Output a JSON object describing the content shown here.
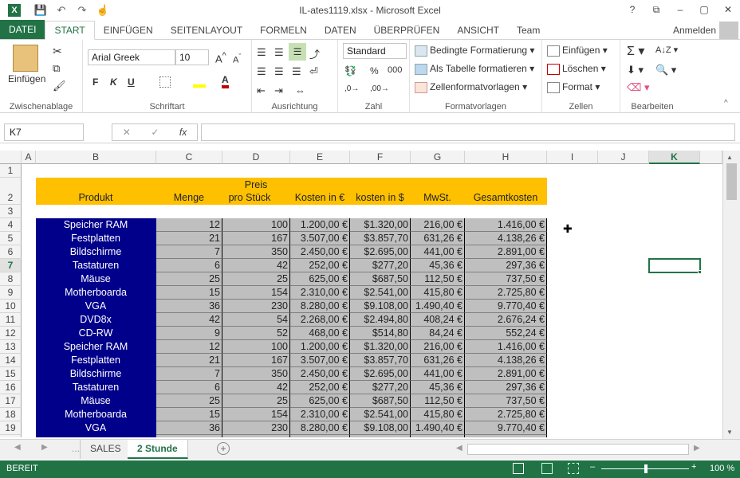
{
  "window": {
    "title": "IL-ates1119.xlsx - Microsoft Excel",
    "controls": [
      "?",
      "⧉",
      "–",
      "▢",
      "✕"
    ]
  },
  "qat": {
    "save": "💾",
    "undo": "↶",
    "redo": "↷",
    "touch": "☝"
  },
  "ribbon_tabs": [
    "DATEI",
    "START",
    "EINFÜGEN",
    "SEITENLAYOUT",
    "FORMELN",
    "DATEN",
    "ÜBERPRÜFEN",
    "ANSICHT",
    "Team"
  ],
  "signin": "Anmelden",
  "ribbon": {
    "clipboard": {
      "paste": "Einfügen",
      "label": "Zwischenablage"
    },
    "font": {
      "name": "Arial Greek",
      "size": "10",
      "bold": "F",
      "italic": "K",
      "underline": "U",
      "label": "Schriftart"
    },
    "alignment": {
      "label": "Ausrichtung"
    },
    "number": {
      "format": "Standard",
      "label": "Zahl"
    },
    "styles": {
      "cond": "Bedingte Formatierung",
      "table": "Als Tabelle formatieren",
      "cell": "Zellenformatvorlagen",
      "label": "Formatvorlagen"
    },
    "cells": {
      "insert": "Einfügen",
      "delete": "Löschen",
      "format": "Format",
      "label": "Zellen"
    },
    "editing": {
      "label": "Bearbeiten"
    }
  },
  "formula": {
    "namebox": "K7",
    "fx": "fx",
    "value": ""
  },
  "columns": [
    "A",
    "B",
    "C",
    "D",
    "E",
    "F",
    "G",
    "H",
    "I",
    "J",
    "K"
  ],
  "header_row": {
    "produkt": "Produkt",
    "menge": "Menge",
    "preis_1": "Preis",
    "preis_2": "pro Stück",
    "kosten_eur": "Kosten in €",
    "kosten_usd": "kosten in $",
    "mwst": "MwSt.",
    "gesamt": "Gesamtkosten"
  },
  "rows": [
    {
      "r": "4",
      "p": "Speicher RAM",
      "m": "12",
      "pr": "100",
      "e": "1.200,00 €",
      "u": "$1.320,00",
      "w": "216,00 €",
      "g": "1.416,00 €"
    },
    {
      "r": "5",
      "p": "Festplatten",
      "m": "21",
      "pr": "167",
      "e": "3.507,00 €",
      "u": "$3.857,70",
      "w": "631,26 €",
      "g": "4.138,26 €"
    },
    {
      "r": "6",
      "p": "Bildschirme",
      "m": "7",
      "pr": "350",
      "e": "2.450,00 €",
      "u": "$2.695,00",
      "w": "441,00 €",
      "g": "2.891,00 €"
    },
    {
      "r": "7",
      "p": "Tastaturen",
      "m": "6",
      "pr": "42",
      "e": "252,00 €",
      "u": "$277,20",
      "w": "45,36 €",
      "g": "297,36 €"
    },
    {
      "r": "8",
      "p": "Mäuse",
      "m": "25",
      "pr": "25",
      "e": "625,00 €",
      "u": "$687,50",
      "w": "112,50 €",
      "g": "737,50 €"
    },
    {
      "r": "9",
      "p": "Motherboarda",
      "m": "15",
      "pr": "154",
      "e": "2.310,00 €",
      "u": "$2.541,00",
      "w": "415,80 €",
      "g": "2.725,80 €"
    },
    {
      "r": "10",
      "p": "VGA",
      "m": "36",
      "pr": "230",
      "e": "8.280,00 €",
      "u": "$9.108,00",
      "w": "1.490,40 €",
      "g": "9.770,40 €"
    },
    {
      "r": "11",
      "p": "DVD8x",
      "m": "42",
      "pr": "54",
      "e": "2.268,00 €",
      "u": "$2.494,80",
      "w": "408,24 €",
      "g": "2.676,24 €"
    },
    {
      "r": "12",
      "p": "CD-RW",
      "m": "9",
      "pr": "52",
      "e": "468,00 €",
      "u": "$514,80",
      "w": "84,24 €",
      "g": "552,24 €"
    },
    {
      "r": "13",
      "p": "Speicher RAM",
      "m": "12",
      "pr": "100",
      "e": "1.200,00 €",
      "u": "$1.320,00",
      "w": "216,00 €",
      "g": "1.416,00 €"
    },
    {
      "r": "14",
      "p": "Festplatten",
      "m": "21",
      "pr": "167",
      "e": "3.507,00 €",
      "u": "$3.857,70",
      "w": "631,26 €",
      "g": "4.138,26 €"
    },
    {
      "r": "15",
      "p": "Bildschirme",
      "m": "7",
      "pr": "350",
      "e": "2.450,00 €",
      "u": "$2.695,00",
      "w": "441,00 €",
      "g": "2.891,00 €"
    },
    {
      "r": "16",
      "p": "Tastaturen",
      "m": "6",
      "pr": "42",
      "e": "252,00 €",
      "u": "$277,20",
      "w": "45,36 €",
      "g": "297,36 €"
    },
    {
      "r": "17",
      "p": "Mäuse",
      "m": "25",
      "pr": "25",
      "e": "625,00 €",
      "u": "$687,50",
      "w": "112,50 €",
      "g": "737,50 €"
    },
    {
      "r": "18",
      "p": "Motherboarda",
      "m": "15",
      "pr": "154",
      "e": "2.310,00 €",
      "u": "$2.541,00",
      "w": "415,80 €",
      "g": "2.725,80 €"
    },
    {
      "r": "19",
      "p": "VGA",
      "m": "36",
      "pr": "230",
      "e": "8.280,00 €",
      "u": "$9.108,00",
      "w": "1.490,40 €",
      "g": "9.770,40 €"
    }
  ],
  "sheets": [
    "SALES",
    "2 Stunde"
  ],
  "active_sheet": "2 Stunde",
  "status": {
    "mode": "BEREIT",
    "zoom": "100 %"
  },
  "colors": {
    "accent": "#217346",
    "product_bg": "#00008b",
    "header_bg": "#ffc000",
    "number_bg": "#bfbfbf"
  }
}
